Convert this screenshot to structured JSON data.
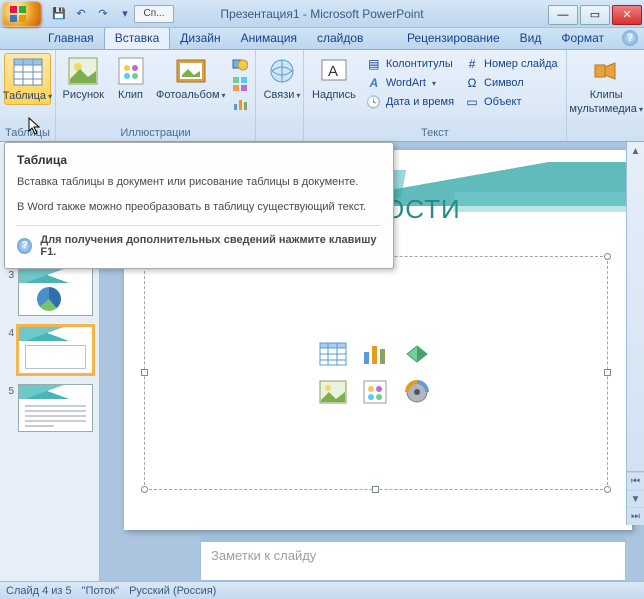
{
  "title": "Презентация1 - Microsoft PowerPoint",
  "spellcheck_btn": "Сп...",
  "qat": {
    "save": "save-icon",
    "undo": "undo-icon",
    "redo": "redo-icon",
    "more": "▾"
  },
  "tabs": {
    "items": [
      "Главная",
      "Вставка",
      "Дизайн",
      "Анимация",
      "Показ слайдов",
      "Рецензирование",
      "Вид"
    ],
    "contextual": "Формат",
    "active_index": 1
  },
  "ribbon": {
    "groups": {
      "tables": {
        "label": "Таблицы",
        "btn": "Таблица"
      },
      "illustrations": {
        "label": "Иллюстрации",
        "picture": "Рисунок",
        "clip": "Клип",
        "album": "Фотоальбом"
      },
      "links": {
        "label": "Связи",
        "btn": "Связи"
      },
      "text": {
        "label": "Текст",
        "inscription": "Надпись",
        "items_col1": [
          "Колонтитулы",
          "WordArt",
          "Дата и время"
        ],
        "items_col2": [
          "Номер слайда",
          "Символ",
          "Объект"
        ]
      },
      "media": {
        "label": "Клипы\nмультимедиа",
        "btn_line1": "Клипы",
        "btn_line2": "мультимедиа"
      }
    }
  },
  "screentip": {
    "title": "Таблица",
    "p1": "Вставка таблицы в документ или рисование таблицы в документе.",
    "p2": "В Word также можно преобразовать в таблицу существующий текст.",
    "f1": "Для получения дополнительных сведений нажмите клавишу F1."
  },
  "slide": {
    "title_fragment": "ОСТИ",
    "notes_placeholder": "Заметки к слайду"
  },
  "thumbs": {
    "visible_numbers": [
      "3",
      "4",
      "5"
    ],
    "selected_index": 1
  },
  "status": {
    "slide": "Слайд 4 из 5",
    "theme": "\"Поток\"",
    "lang": "Русский (Россия)"
  }
}
